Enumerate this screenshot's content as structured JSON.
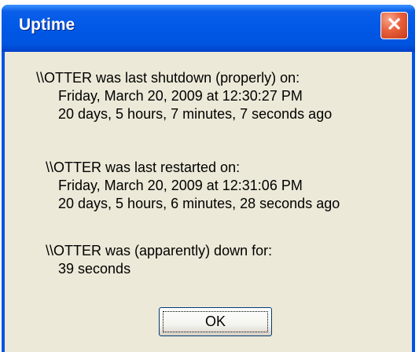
{
  "window": {
    "title": "Uptime",
    "close_glyph": "✕"
  },
  "shutdown": {
    "heading": "\\\\OTTER was last shutdown (properly) on:",
    "date": "Friday, March 20, 2009 at 12:30:27 PM",
    "ago": "20 days, 5 hours, 7 minutes, 7 seconds ago"
  },
  "restart": {
    "heading": "\\\\OTTER was last restarted on:",
    "date": "Friday, March 20, 2009 at 12:31:06 PM",
    "ago": "20 days, 5 hours, 6 minutes, 28 seconds ago"
  },
  "downtime": {
    "heading": "\\\\OTTER was (apparently) down for:",
    "value": "39 seconds"
  },
  "buttons": {
    "ok_label": "OK"
  },
  "icons": {
    "close": "close-icon"
  },
  "colors": {
    "titlebar": "#0054e3",
    "client": "#ece9d8",
    "close": "#e8603c"
  }
}
